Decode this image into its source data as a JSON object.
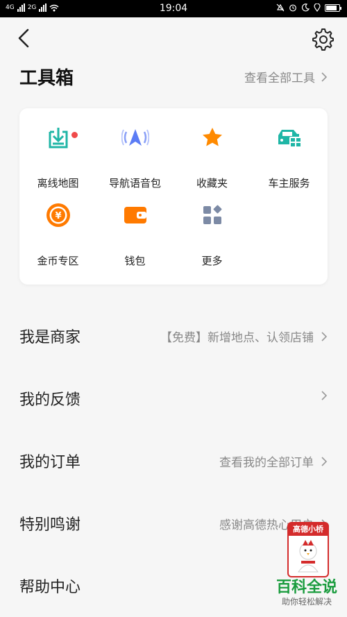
{
  "status_bar": {
    "network_labels": [
      "4G",
      "2G"
    ],
    "time": "19:04",
    "battery_level": 0.85
  },
  "header": {
    "back_icon": "chevron-left-icon",
    "settings_icon": "gear-icon"
  },
  "toolbox": {
    "title": "工具箱",
    "view_all": "查看全部工具",
    "tools": [
      {
        "label": "离线地图",
        "icon": "download-map-icon",
        "color": "#1fb6a6",
        "has_dot": true
      },
      {
        "label": "导航语音包",
        "icon": "navigation-voice-icon",
        "color": "#5b7cf5",
        "has_dot": false
      },
      {
        "label": "收藏夹",
        "icon": "star-icon",
        "color": "#ff8a00",
        "has_dot": false
      },
      {
        "label": "车主服务",
        "icon": "car-service-icon",
        "color": "#1fb6a6",
        "has_dot": false
      },
      {
        "label": "金币专区",
        "icon": "coin-icon",
        "color": "#ff7a00",
        "has_dot": false
      },
      {
        "label": "钱包",
        "icon": "wallet-icon",
        "color": "#ff7a00",
        "has_dot": false
      },
      {
        "label": "更多",
        "icon": "more-grid-icon",
        "color": "#7c8aa5",
        "has_dot": false
      }
    ]
  },
  "menu": [
    {
      "title": "我是商家",
      "sub": "【免费】新增地点、认领店铺"
    },
    {
      "title": "我的反馈",
      "sub": ""
    },
    {
      "title": "我的订单",
      "sub": "查看我的全部订单"
    },
    {
      "title": "特别鸣谢",
      "sub": "感谢高德热心用户"
    },
    {
      "title": "帮助中心",
      "sub": ""
    }
  ],
  "watermark": {
    "badge": "高德小桥",
    "brand": "百科全说",
    "slogan": "助你轻松解决"
  },
  "colors": {
    "notification_dot": "#f04a4a",
    "watermark_brand": "#1a9c3e",
    "watermark_badge": "#d42b2b"
  }
}
